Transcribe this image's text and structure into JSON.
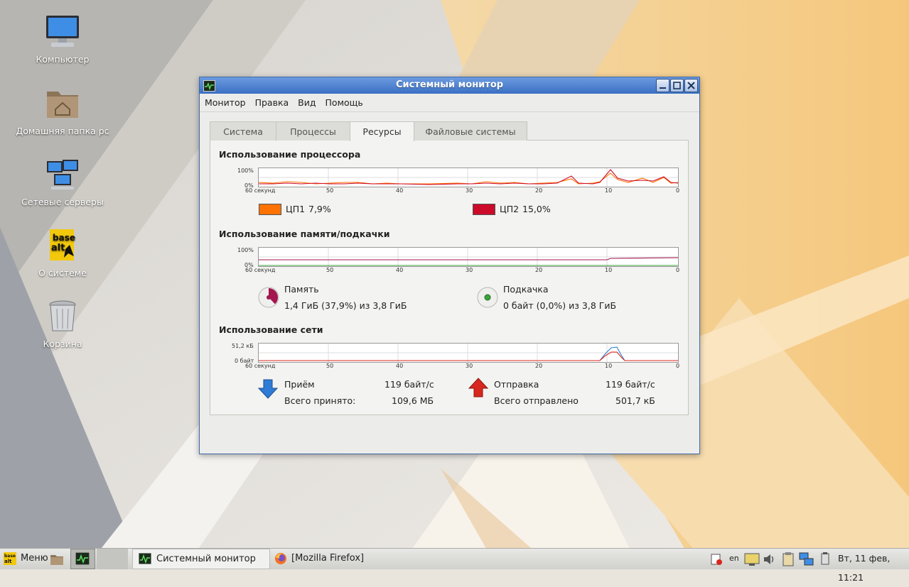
{
  "desktop": {
    "icons": [
      {
        "label": "Компьютер",
        "icon": "computer-icon"
      },
      {
        "label": "Домашняя папка pc",
        "icon": "home-folder-icon"
      },
      {
        "label": "Сетевые серверы",
        "icon": "network-servers-icon"
      },
      {
        "label": "О системе",
        "icon": "basealt-logo-icon"
      },
      {
        "label": "Корзина",
        "icon": "trash-icon"
      }
    ]
  },
  "window": {
    "title": "Системный монитор",
    "menu": [
      "Монитор",
      "Правка",
      "Вид",
      "Помощь"
    ],
    "tabs": [
      "Система",
      "Процессы",
      "Ресурсы",
      "Файловые системы"
    ],
    "active_tab": "Ресурсы",
    "colors": {
      "cpu1": "#ff7200",
      "cpu2": "#cc0a2a",
      "memory": "#a3164e",
      "swap": "#3ca33c",
      "receive": "#2f7cd6",
      "send": "#d8271e",
      "title_bar": "#4a7fcf"
    },
    "cpu": {
      "title": "Использование процессора",
      "y_top": "100%",
      "y_bottom": "0%",
      "x_first": "60 секунд",
      "x_ticks": [
        "50",
        "40",
        "30",
        "20",
        "10",
        "0"
      ],
      "legend": [
        {
          "name": "ЦП1",
          "value": "7,9%"
        },
        {
          "name": "ЦП2",
          "value": "15,0%"
        }
      ]
    },
    "memory": {
      "title": "Использование памяти/подкачки",
      "y_top": "100%",
      "y_bottom": "0%",
      "x_first": "60 секунд",
      "x_ticks": [
        "50",
        "40",
        "30",
        "20",
        "10",
        "0"
      ],
      "mem_label": "Память",
      "mem_value": "1,4 ГиБ (37,9%) из 3,8 ГиБ",
      "mem_fraction": 0.379,
      "swap_label": "Подкачка",
      "swap_value": "0 байт (0,0%) из 3,8 ГиБ",
      "swap_fraction": 0.0
    },
    "network": {
      "title": "Использование сети",
      "y_top": "51,2 кБ",
      "y_bottom": "0 байт",
      "x_first": "60 секунд",
      "x_ticks": [
        "50",
        "40",
        "30",
        "20",
        "10",
        "0"
      ],
      "recv_label": "Приём",
      "recv_rate": "119 байт/с",
      "recv_total_label": "Всего принято:",
      "recv_total": "109,6 МБ",
      "send_label": "Отправка",
      "send_rate": "119 байт/с",
      "send_total_label": "Всего отправлено",
      "send_total": "501,7 кБ"
    }
  },
  "taskbar": {
    "menu_label": "Меню",
    "tasks": [
      "Системный монитор",
      "[Mozilla Firefox]"
    ],
    "keyboard_layout": "en",
    "clock": "Вт, 11 фев, 11:21"
  }
}
